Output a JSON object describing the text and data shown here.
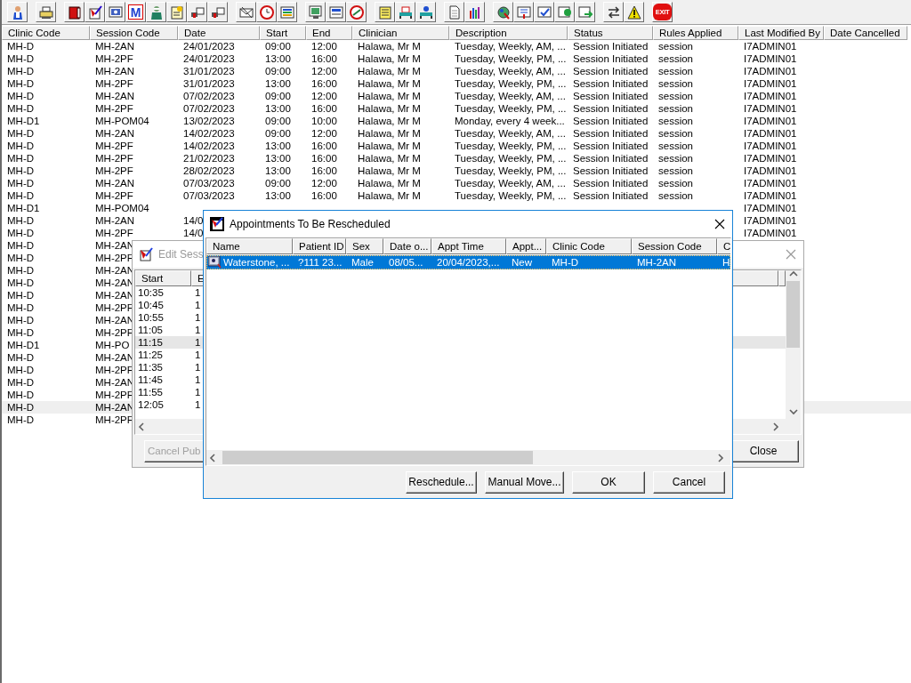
{
  "toolbar": {
    "mail_letter": "M",
    "exit_label": "EXIT"
  },
  "sessions": {
    "columns": [
      "Clinic Code",
      "Session Code",
      "Date",
      "Start",
      "End",
      "Clinician",
      "Description",
      "Status",
      "Rules Applied",
      "Last Modified By",
      "Date Cancelled"
    ],
    "rows": [
      {
        "clinic_code": "MH-D",
        "session_code": "MH-2AN",
        "date": "24/01/2023",
        "start": "09:00",
        "end": "12:00",
        "clinician": "Halawa, Mr M",
        "description": "Tuesday, Weekly, AM, ...",
        "status": "Session Initiated",
        "rules_applied": "session",
        "last_modified_by": "I7ADMIN01",
        "selected": false
      },
      {
        "clinic_code": "MH-D",
        "session_code": "MH-2PF",
        "date": "24/01/2023",
        "start": "13:00",
        "end": "16:00",
        "clinician": "Halawa, Mr M",
        "description": "Tuesday, Weekly, PM, ...",
        "status": "Session Initiated",
        "rules_applied": "session",
        "last_modified_by": "I7ADMIN01",
        "selected": false
      },
      {
        "clinic_code": "MH-D",
        "session_code": "MH-2AN",
        "date": "31/01/2023",
        "start": "09:00",
        "end": "12:00",
        "clinician": "Halawa, Mr M",
        "description": "Tuesday, Weekly, AM, ...",
        "status": "Session Initiated",
        "rules_applied": "session",
        "last_modified_by": "I7ADMIN01",
        "selected": false
      },
      {
        "clinic_code": "MH-D",
        "session_code": "MH-2PF",
        "date": "31/01/2023",
        "start": "13:00",
        "end": "16:00",
        "clinician": "Halawa, Mr M",
        "description": "Tuesday, Weekly, PM, ...",
        "status": "Session Initiated",
        "rules_applied": "session",
        "last_modified_by": "I7ADMIN01",
        "selected": false
      },
      {
        "clinic_code": "MH-D",
        "session_code": "MH-2AN",
        "date": "07/02/2023",
        "start": "09:00",
        "end": "12:00",
        "clinician": "Halawa, Mr M",
        "description": "Tuesday, Weekly, AM, ...",
        "status": "Session Initiated",
        "rules_applied": "session",
        "last_modified_by": "I7ADMIN01",
        "selected": false
      },
      {
        "clinic_code": "MH-D",
        "session_code": "MH-2PF",
        "date": "07/02/2023",
        "start": "13:00",
        "end": "16:00",
        "clinician": "Halawa, Mr M",
        "description": "Tuesday, Weekly, PM, ...",
        "status": "Session Initiated",
        "rules_applied": "session",
        "last_modified_by": "I7ADMIN01",
        "selected": false
      },
      {
        "clinic_code": "MH-D1",
        "session_code": "MH-POM04",
        "date": "13/02/2023",
        "start": "09:00",
        "end": "10:00",
        "clinician": "Halawa, Mr M",
        "description": "Monday, every 4 week...",
        "status": "Session Initiated",
        "rules_applied": "session",
        "last_modified_by": "I7ADMIN01",
        "selected": false
      },
      {
        "clinic_code": "MH-D",
        "session_code": "MH-2AN",
        "date": "14/02/2023",
        "start": "09:00",
        "end": "12:00",
        "clinician": "Halawa, Mr M",
        "description": "Tuesday, Weekly, AM, ...",
        "status": "Session Initiated",
        "rules_applied": "session",
        "last_modified_by": "I7ADMIN01",
        "selected": false
      },
      {
        "clinic_code": "MH-D",
        "session_code": "MH-2PF",
        "date": "14/02/2023",
        "start": "13:00",
        "end": "16:00",
        "clinician": "Halawa, Mr M",
        "description": "Tuesday, Weekly, PM, ...",
        "status": "Session Initiated",
        "rules_applied": "session",
        "last_modified_by": "I7ADMIN01",
        "selected": false
      },
      {
        "clinic_code": "MH-D",
        "session_code": "MH-2PF",
        "date": "21/02/2023",
        "start": "13:00",
        "end": "16:00",
        "clinician": "Halawa, Mr M",
        "description": "Tuesday, Weekly, PM, ...",
        "status": "Session Initiated",
        "rules_applied": "session",
        "last_modified_by": "I7ADMIN01",
        "selected": false
      },
      {
        "clinic_code": "MH-D",
        "session_code": "MH-2PF",
        "date": "28/02/2023",
        "start": "13:00",
        "end": "16:00",
        "clinician": "Halawa, Mr M",
        "description": "Tuesday, Weekly, PM, ...",
        "status": "Session Initiated",
        "rules_applied": "session",
        "last_modified_by": "I7ADMIN01",
        "selected": false
      },
      {
        "clinic_code": "MH-D",
        "session_code": "MH-2AN",
        "date": "07/03/2023",
        "start": "09:00",
        "end": "12:00",
        "clinician": "Halawa, Mr M",
        "description": "Tuesday, Weekly, AM, ...",
        "status": "Session Initiated",
        "rules_applied": "session",
        "last_modified_by": "I7ADMIN01",
        "selected": false
      },
      {
        "clinic_code": "MH-D",
        "session_code": "MH-2PF",
        "date": "07/03/2023",
        "start": "13:00",
        "end": "16:00",
        "clinician": "Halawa, Mr M",
        "description": "Tuesday, Weekly, PM, ...",
        "status": "Session Initiated",
        "rules_applied": "session",
        "last_modified_by": "I7ADMIN01",
        "selected": false
      },
      {
        "clinic_code": "MH-D1",
        "session_code": "MH-POM04",
        "last_modified_by": "I7ADMIN01",
        "selected": false
      },
      {
        "clinic_code": "MH-D",
        "session_code": "MH-2AN",
        "date": "14/0",
        "last_modified_by": "I7ADMIN01",
        "selected": false
      },
      {
        "clinic_code": "MH-D",
        "session_code": "MH-2PF",
        "date": "14/0",
        "last_modified_by": "I7ADMIN01",
        "selected": false
      },
      {
        "clinic_code": "MH-D",
        "session_code": "MH-2AN",
        "selected": false
      },
      {
        "clinic_code": "MH-D",
        "session_code": "MH-2PF",
        "selected": false
      },
      {
        "clinic_code": "MH-D",
        "session_code": "MH-2AN",
        "selected": false
      },
      {
        "clinic_code": "MH-D",
        "session_code": "MH-2AN",
        "selected": false
      },
      {
        "clinic_code": "MH-D",
        "session_code": "MH-2AN",
        "selected": false
      },
      {
        "clinic_code": "MH-D",
        "session_code": "MH-2PF",
        "selected": false
      },
      {
        "clinic_code": "MH-D",
        "session_code": "MH-2AN",
        "selected": false
      },
      {
        "clinic_code": "MH-D",
        "session_code": "MH-2PF",
        "selected": false
      },
      {
        "clinic_code": "MH-D1",
        "session_code": "MH-PO",
        "selected": false
      },
      {
        "clinic_code": "MH-D",
        "session_code": "MH-2AN",
        "selected": false
      },
      {
        "clinic_code": "MH-D",
        "session_code": "MH-2PF",
        "selected": false
      },
      {
        "clinic_code": "MH-D",
        "session_code": "MH-2AN",
        "selected": false
      },
      {
        "clinic_code": "MH-D",
        "session_code": "MH-2PF",
        "selected": false
      },
      {
        "clinic_code": "MH-D",
        "session_code": "MH-2AN",
        "selected": true
      },
      {
        "clinic_code": "MH-D",
        "session_code": "MH-2PF",
        "selected": false
      }
    ]
  },
  "edit_window": {
    "title": "Edit Sess",
    "columns": [
      "Start",
      "E"
    ],
    "rows": [
      {
        "start": "10:35",
        "end": "1",
        "selected": false
      },
      {
        "start": "10:45",
        "end": "1",
        "selected": false
      },
      {
        "start": "10:55",
        "end": "1",
        "selected": false
      },
      {
        "start": "11:05",
        "end": "1",
        "selected": false
      },
      {
        "start": "11:15",
        "end": "1",
        "selected": true
      },
      {
        "start": "11:25",
        "end": "1",
        "selected": false
      },
      {
        "start": "11:35",
        "end": "1",
        "selected": false
      },
      {
        "start": "11:45",
        "end": "1",
        "selected": false
      },
      {
        "start": "11:55",
        "end": "1",
        "selected": false
      },
      {
        "start": "12:05",
        "end": "1",
        "selected": false
      }
    ],
    "buttons": [
      {
        "label": "Cancel Pub",
        "disabled": true
      },
      {
        "label": "Close",
        "disabled": false
      }
    ]
  },
  "dialog": {
    "title": "Appointments To Be Rescheduled",
    "columns": [
      "Name",
      "Patient ID",
      "Sex",
      "Date o...",
      "Appt Time",
      "Appt...",
      "Clinic Code",
      "Session Code",
      "C"
    ],
    "rows": [
      {
        "cells": [
          "Waterstone, ...",
          "?111 23...",
          "Male",
          "08/05...",
          "20/04/2023,...",
          "New",
          "MH-D",
          "MH-2AN",
          "H"
        ],
        "selected": true
      }
    ],
    "buttons": [
      "Reschedule...",
      "Manual Move...",
      "OK",
      "Cancel"
    ]
  }
}
